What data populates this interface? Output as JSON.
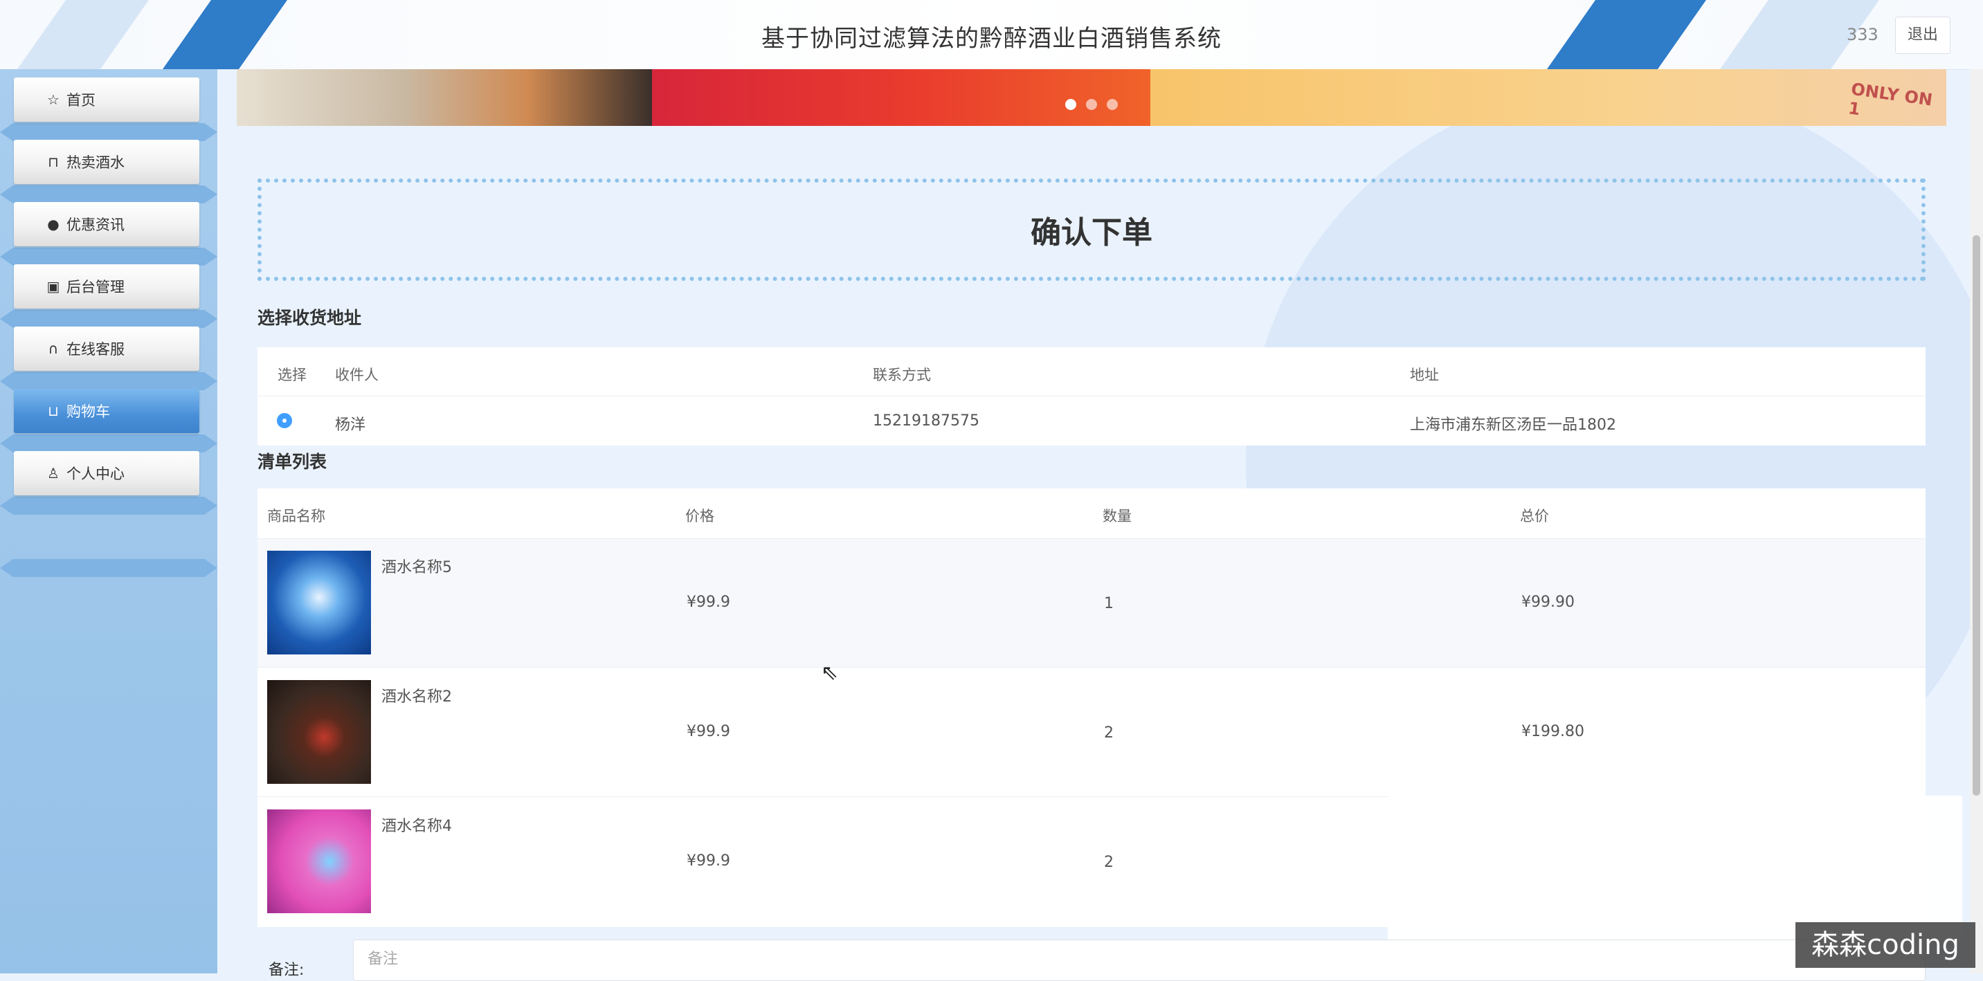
{
  "header": {
    "title": "基于协同过滤算法的黔醉酒业白酒销售系统",
    "username": "333",
    "logout_label": "退出"
  },
  "sidebar": {
    "items": [
      {
        "label": "首页",
        "icon": "star-icon"
      },
      {
        "label": "热卖酒水",
        "icon": "bag-icon"
      },
      {
        "label": "优惠资讯",
        "icon": "info-icon"
      },
      {
        "label": "后台管理",
        "icon": "box-icon"
      },
      {
        "label": "在线客服",
        "icon": "headset-icon"
      },
      {
        "label": "购物车",
        "icon": "cart-icon",
        "active": true
      },
      {
        "label": "个人中心",
        "icon": "user-icon"
      }
    ]
  },
  "banner": {
    "tag_text": "ONLY ON 1"
  },
  "page": {
    "title": "确认下单"
  },
  "address": {
    "section_label": "选择收货地址",
    "columns": [
      "选择",
      "收件人",
      "联系方式",
      "地址"
    ],
    "rows": [
      {
        "recipient": "杨洋",
        "phone": "15219187575",
        "address": "上海市浦东新区汤臣一品1802",
        "selected": true
      }
    ]
  },
  "order_list": {
    "section_label": "清单列表",
    "columns": [
      "商品名称",
      "价格",
      "数量",
      "总价"
    ],
    "rows": [
      {
        "name": "酒水名称5",
        "price": "¥99.9",
        "quantity": "1",
        "total": "¥99.90"
      },
      {
        "name": "酒水名称2",
        "price": "¥99.9",
        "quantity": "2",
        "total": "¥199.80"
      },
      {
        "name": "酒水名称4",
        "price": "¥99.9",
        "quantity": "2",
        "total": ""
      }
    ]
  },
  "remark": {
    "label": "备注:",
    "placeholder": "备注"
  },
  "watermark": "森森coding"
}
